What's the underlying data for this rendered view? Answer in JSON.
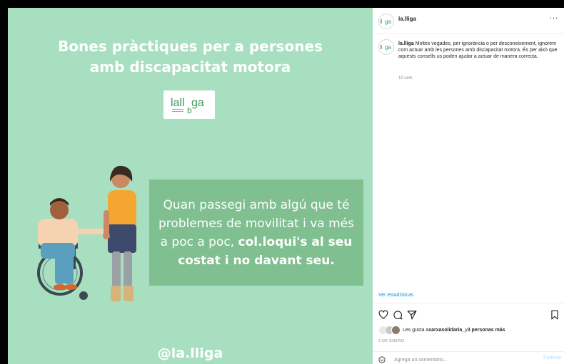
{
  "post": {
    "headline_line1": "Bones pràctiques per a persones",
    "headline_line2": "amb discapacitat motora",
    "logo_text": "lalliga",
    "quote_regular": "Quan passegi amb algú que té problemes de movilitat i va més a poc a poc, ",
    "quote_bold": "col.loqui's al seu costat i no davant seu.",
    "bottom_handle": "@la.lliga"
  },
  "sidebar": {
    "username": "la.lliga",
    "more_label": "...",
    "caption_user": "la.lliga",
    "caption_text": " Moltes vegades, per ignorància o per desconeixement, ignorem com actuar amb les persones amb discapacitat motora. És per això que aquests consells us poden ajudar a actuar de manera correcta.",
    "time_ago": "10 sem",
    "stats_link": "Ver estadísticas",
    "likes_prefix": "Les gusta a ",
    "likes_user": "xarxasolidaria_",
    "likes_middle": " y ",
    "likes_count": "3 personas más",
    "date": "3 DE ENERO",
    "comment_placeholder": "Agrega un comentario...",
    "publish_label": "Publicar"
  },
  "colors": {
    "post_bg": "#a8dfc0",
    "quote_bg": "#7fbf90",
    "link_blue": "#0095f6",
    "publish_disabled": "#b2dffc"
  },
  "icons": [
    "logo-icon",
    "heart-icon",
    "comment-icon",
    "share-icon",
    "bookmark-icon",
    "emoji-icon",
    "more-icon"
  ]
}
